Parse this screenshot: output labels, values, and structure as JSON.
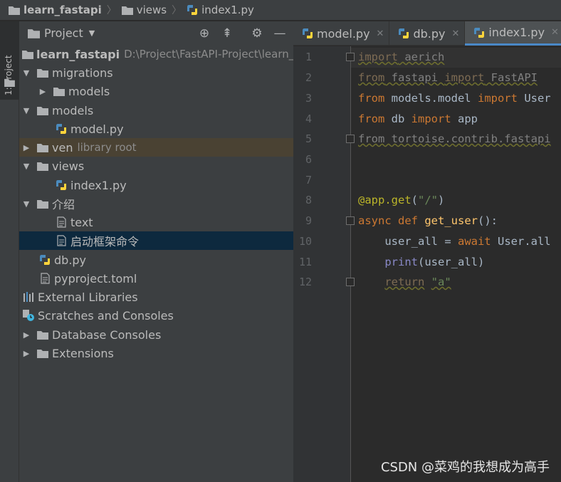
{
  "breadcrumb": [
    {
      "label": "learn_fastapi",
      "icon": "folder-icon"
    },
    {
      "label": "views",
      "icon": "folder-icon"
    },
    {
      "label": "index1.py",
      "icon": "python-file-icon"
    }
  ],
  "tool_strip": {
    "label": "1: Project"
  },
  "panel": {
    "title": "Project"
  },
  "tree": [
    {
      "label": "learn_fastapi",
      "hint": "D:\\Project\\FastAPI-Project\\learn_fas"
    },
    {
      "label": "migrations"
    },
    {
      "label": "models"
    },
    {
      "label": "models"
    },
    {
      "label": "model.py"
    },
    {
      "label": "ven",
      "hint": "library root"
    },
    {
      "label": "views"
    },
    {
      "label": "index1.py"
    },
    {
      "label": "介绍"
    },
    {
      "label": "text"
    },
    {
      "label": "启动框架命令"
    },
    {
      "label": "db.py"
    },
    {
      "label": "pyproject.toml"
    },
    {
      "label": "External Libraries"
    },
    {
      "label": "Scratches and Consoles"
    },
    {
      "label": "Database Consoles"
    },
    {
      "label": "Extensions"
    }
  ],
  "tabs": [
    {
      "label": "model.py",
      "active": false
    },
    {
      "label": "db.py",
      "active": false
    },
    {
      "label": "index1.py",
      "active": true
    }
  ],
  "line_numbers": [
    "1",
    "2",
    "3",
    "4",
    "5",
    "6",
    "7",
    "8",
    "9",
    "10",
    "11",
    "12"
  ],
  "code": {
    "l1_a": "import",
    "l1_b": " aerich",
    "l2_a": "from",
    "l2_b": " fastapi ",
    "l2_c": "import",
    "l2_d": " FastAPI",
    "l3_a": "from",
    "l3_b": " models.model ",
    "l3_c": "import",
    "l3_d": " User",
    "l4_a": "from",
    "l4_b": " db ",
    "l4_c": "import",
    "l4_d": " app",
    "l5": "from tortoise.contrib.fastapi",
    "l8_a": "@app.get",
    "l8_b": "(",
    "l8_c": "\"/\"",
    "l8_d": ")",
    "l9_a": "async def ",
    "l9_b": "get_user",
    "l9_c": "():",
    "l10_a": "    user_all = ",
    "l10_b": "await",
    "l10_c": " User.all",
    "l11_a": "    ",
    "l11_b": "print",
    "l11_c": "(user_all)",
    "l12_a": "    ",
    "l12_b": "return",
    "l12_c": " ",
    "l12_d": "\"a\""
  },
  "watermark": "CSDN @菜鸡的我想成为高手",
  "colors": {
    "accent": "#4a88c7",
    "selection": "#0d293e",
    "keyword": "#cc7832",
    "string": "#6a8759"
  }
}
